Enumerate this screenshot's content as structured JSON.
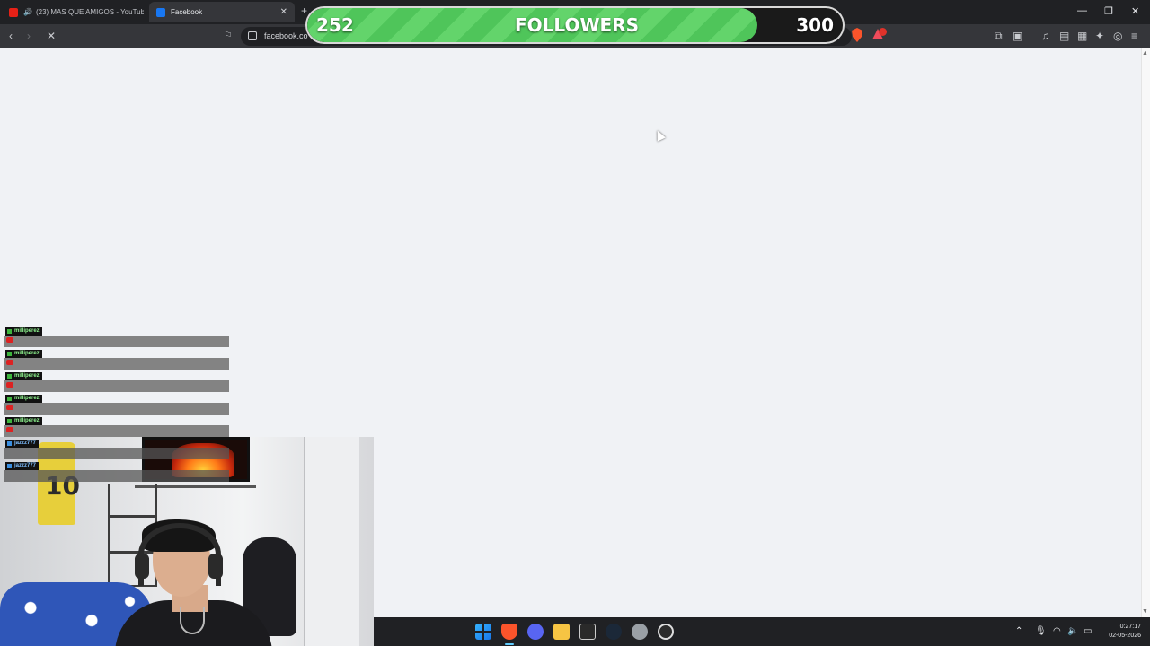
{
  "browser": {
    "tabs": [
      {
        "title": "(23) MAS QUE AMIGOS - YouTub",
        "active": false
      },
      {
        "title": "Facebook",
        "active": true
      }
    ],
    "address": "facebook.co"
  },
  "goal": {
    "current": "252",
    "label": "FOLLOWERS",
    "target": "300",
    "progress_fraction": 0.84
  },
  "chat": {
    "messages": [
      {
        "user": "milliperez"
      },
      {
        "user": "milliperez"
      },
      {
        "user": "milliperez"
      },
      {
        "user": "milliperez"
      },
      {
        "user": "milliperez"
      },
      {
        "user": "jazzz777"
      },
      {
        "user": "jazzz777"
      }
    ]
  },
  "webcam": {
    "jersey_number": "10"
  },
  "taskbar": {
    "time": "0:27:17",
    "date": "02-05-2026"
  },
  "colors": {
    "goal_fill": "#4fc55a",
    "page_bg": "#f0f2f5",
    "taskbar_bg": "#202124"
  }
}
